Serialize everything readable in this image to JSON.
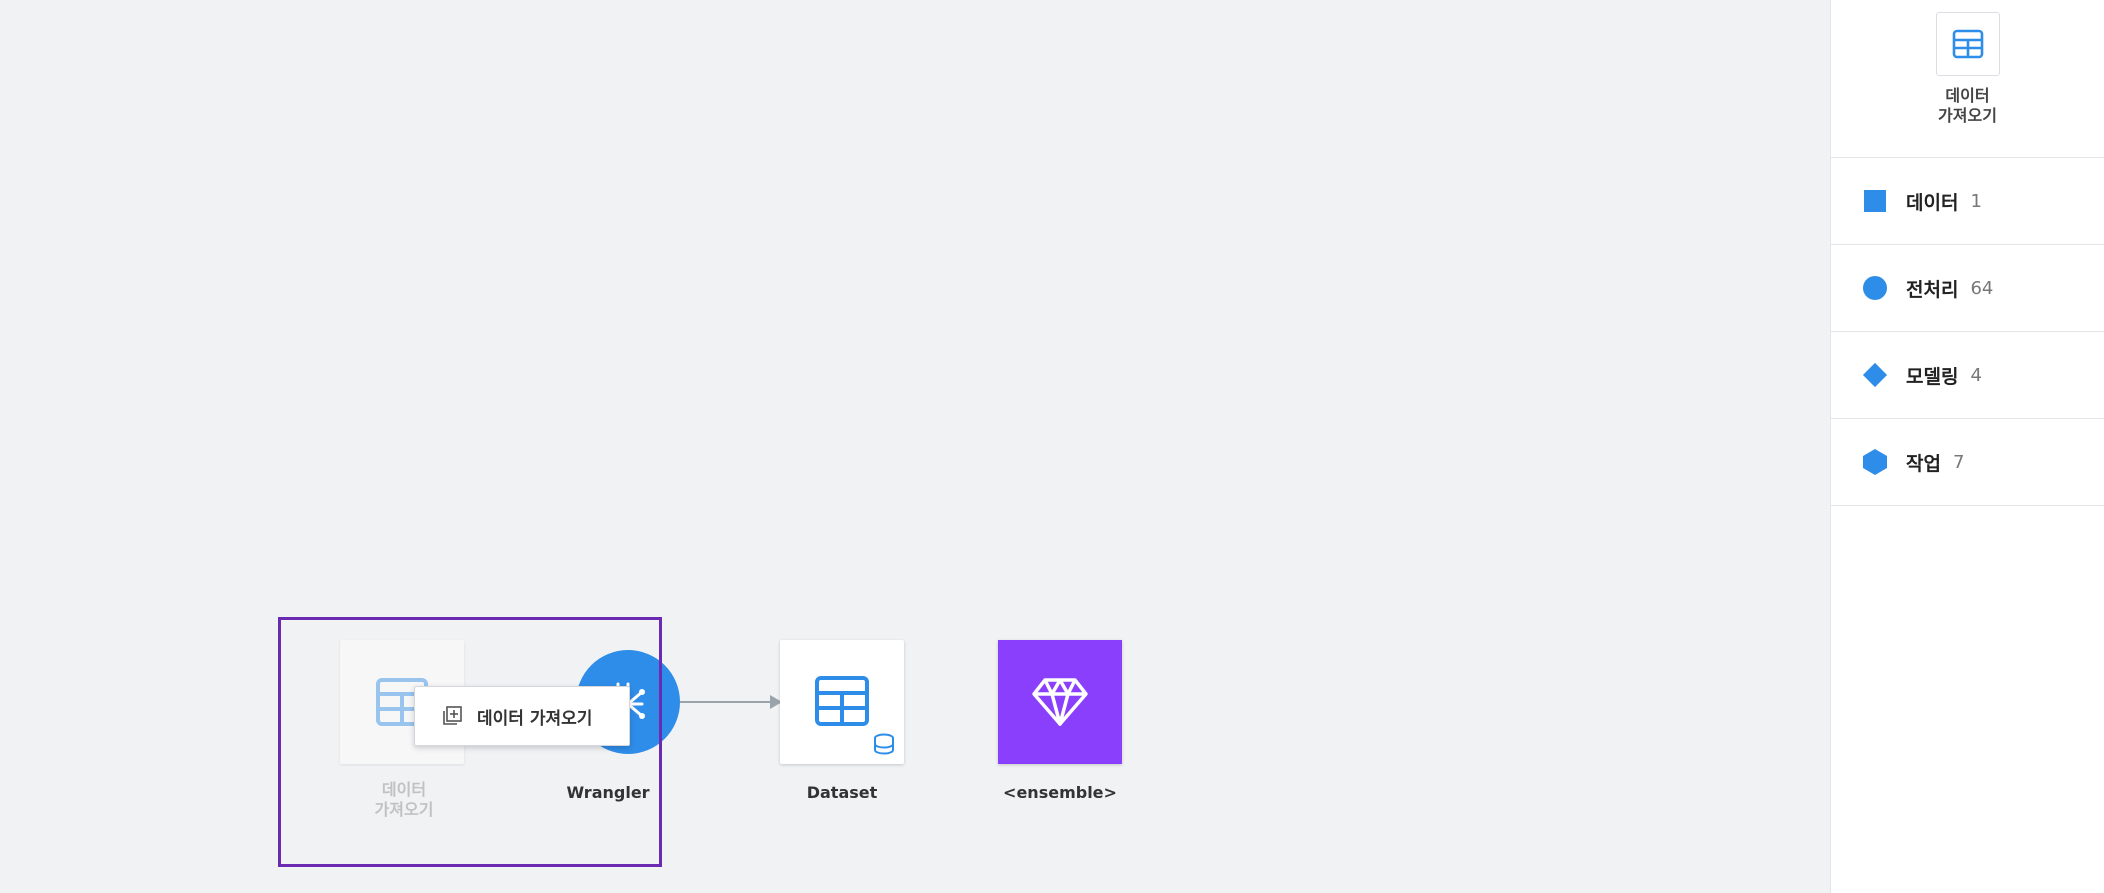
{
  "side_panel": {
    "import_button": {
      "label_line1": "데이터",
      "label_line2": "가져오기",
      "icon": "table-icon"
    },
    "categories": [
      {
        "label": "데이터",
        "count": "1",
        "icon": "square-icon",
        "color": "#2e8de8"
      },
      {
        "label": "전처리",
        "count": "64",
        "icon": "circle-icon",
        "color": "#2e8de8"
      },
      {
        "label": "모델링",
        "count": "4",
        "icon": "diamond-icon",
        "color": "#2e8de8"
      },
      {
        "label": "작업",
        "count": "7",
        "icon": "hexagon-icon",
        "color": "#2e8de8"
      }
    ]
  },
  "canvas": {
    "nodes": {
      "import_ghost": {
        "label_line1": "데이터",
        "label_line2": "가져오기",
        "icon": "table-icon"
      },
      "wrangler": {
        "label": "Wrangler",
        "icon": "wrangler-icon",
        "color": "#2e8de8"
      },
      "dataset": {
        "label": "Dataset",
        "icon": "table-database-icon",
        "color": "#2e8de8"
      },
      "ensemble": {
        "label": "<ensemble>",
        "icon": "diamond-gem-icon",
        "color": "#8a3ffc"
      }
    },
    "tooltip": {
      "label": "데이터 가져오기",
      "icon": "add-copy-icon"
    }
  },
  "colors": {
    "accent": "#2e8de8",
    "ensemble": "#8a3ffc",
    "highlight": "#6a2ab1",
    "canvas_bg": "#f1f2f4"
  }
}
